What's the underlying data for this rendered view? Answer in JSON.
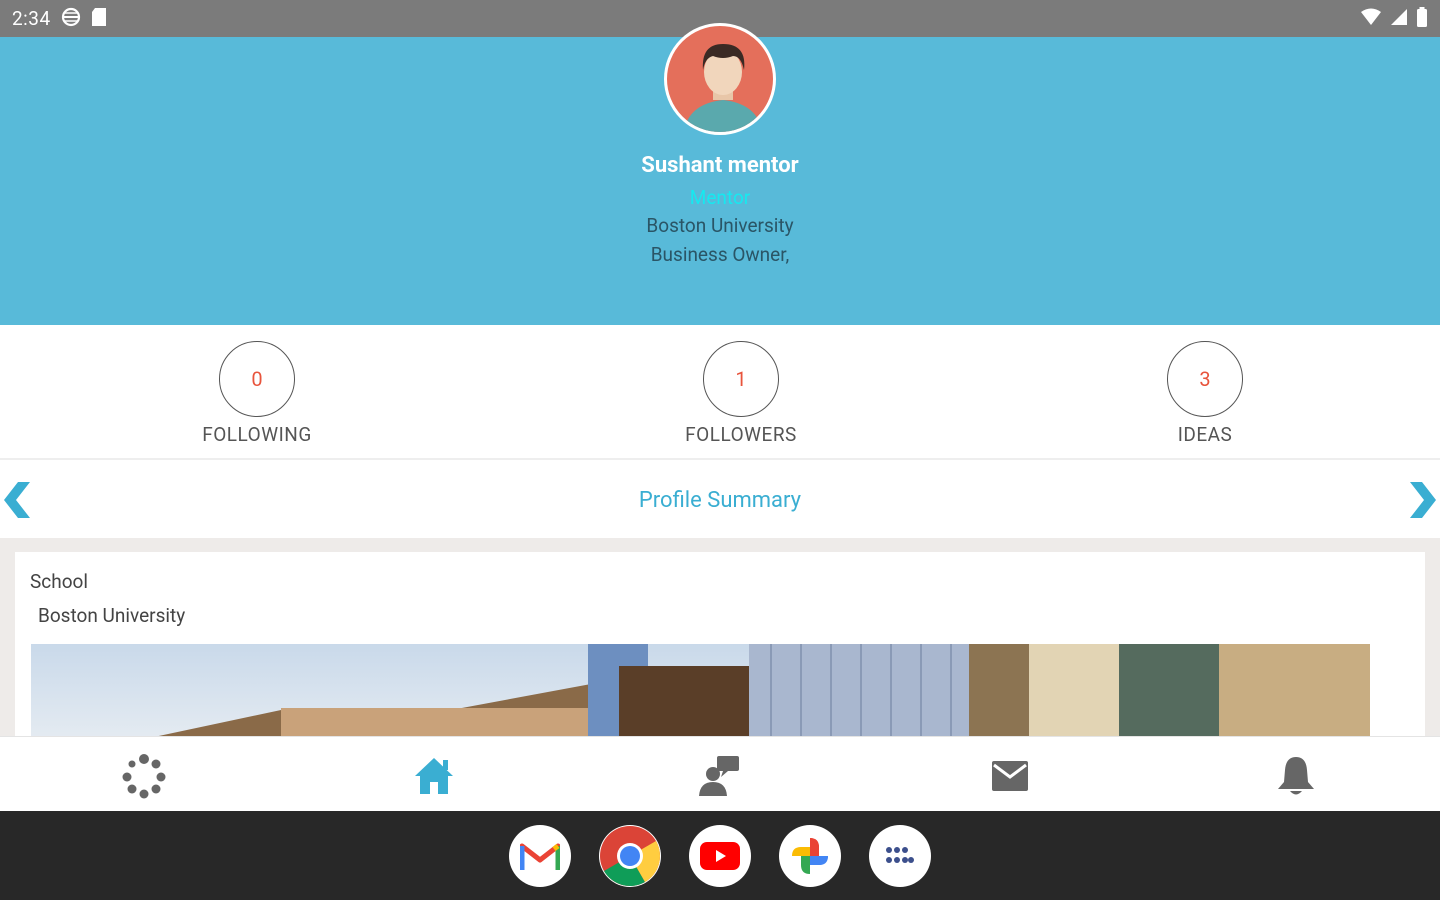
{
  "status_bar": {
    "time": "2:34",
    "icons": [
      "vpn-globe-icon",
      "sd-card-icon",
      "wifi-icon",
      "cell-signal-icon",
      "battery-icon"
    ]
  },
  "profile": {
    "name": "Sushant mentor",
    "role": "Mentor",
    "school": "Boston University",
    "job": "Business Owner,",
    "header_color": "#58bad9",
    "avatar_color": "#e46f5b"
  },
  "stats": [
    {
      "value": "0",
      "label": "FOLLOWING"
    },
    {
      "value": "1",
      "label": "FOLLOWERS"
    },
    {
      "value": "3",
      "label": "IDEAS"
    }
  ],
  "section": {
    "title": "Profile Summary",
    "accent": "#3aaed2"
  },
  "card": {
    "label": "School",
    "value": "Boston University"
  },
  "bottom_nav": {
    "items": [
      "dots-icon",
      "home-icon",
      "users-chat-icon",
      "mail-icon",
      "bell-icon"
    ],
    "active": "home-icon"
  },
  "taskbar": {
    "apps": [
      "gmail-icon",
      "chrome-icon",
      "youtube-icon",
      "photos-icon",
      "app-drawer-icon"
    ]
  }
}
